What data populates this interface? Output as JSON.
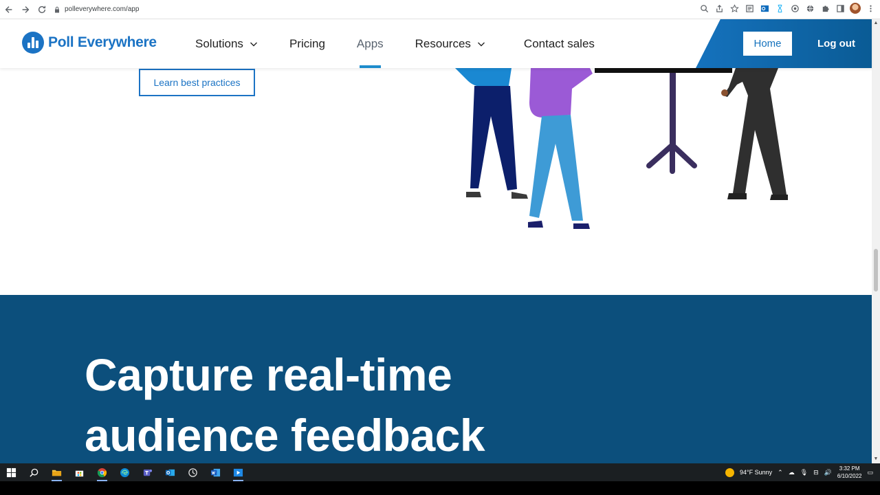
{
  "browser": {
    "url": "polleverywhere.com/app"
  },
  "header": {
    "logo_text": "Poll Everywhere",
    "nav": {
      "solutions": "Solutions",
      "pricing": "Pricing",
      "apps": "Apps",
      "resources": "Resources",
      "contact": "Contact sales"
    },
    "home_label": "Home",
    "logout_label": "Log out"
  },
  "content": {
    "practices_button": "Learn best practices",
    "feedback_title_line1": "Capture real-time",
    "feedback_title_line2": "audience feedback"
  },
  "taskbar": {
    "weather": "94°F  Sunny",
    "time": "3:32 PM",
    "date": "6/10/2022"
  },
  "colors": {
    "brand_blue": "#1b73c4",
    "section_blue": "#0c4f7c",
    "active_underline": "#1e8ccc"
  }
}
